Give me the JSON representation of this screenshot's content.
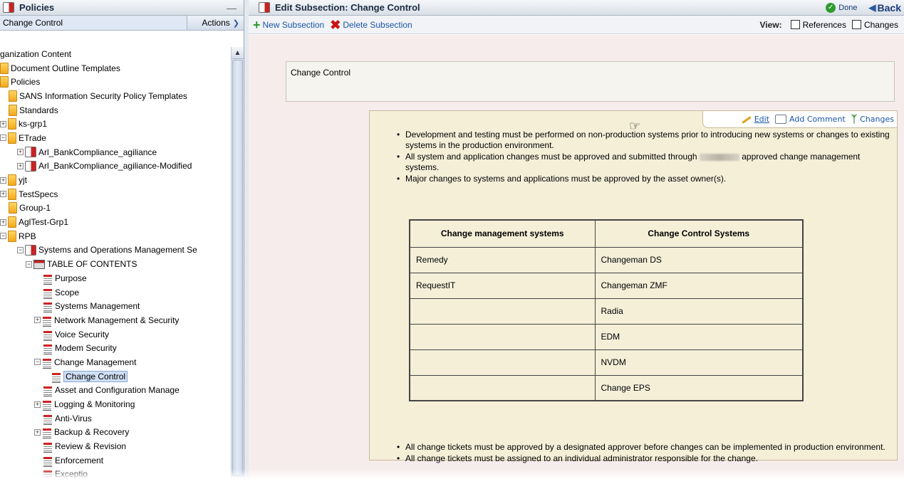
{
  "left_panel": {
    "title": "Policies",
    "minimize": "—",
    "context": "Change Control",
    "actions_label": "Actions",
    "scroll_up": "▲",
    "tree": [
      {
        "label": "ganization Content",
        "indent": 0,
        "expander": "",
        "icon": "none"
      },
      {
        "label": "Document Outline Templates",
        "indent": 0,
        "expander": "",
        "icon": "folder"
      },
      {
        "label": "Policies",
        "indent": 0,
        "expander": "",
        "icon": "folder"
      },
      {
        "label": "SANS Information Security Policy Templates",
        "indent": 1,
        "expander": "",
        "icon": "folder"
      },
      {
        "label": "Standards",
        "indent": 1,
        "expander": "",
        "icon": "folder"
      },
      {
        "label": "ks-grp1",
        "indent": 0,
        "expander": "+",
        "icon": "folder"
      },
      {
        "label": "ETrade",
        "indent": 0,
        "expander": "−",
        "icon": "folder"
      },
      {
        "label": "Arl_BankCompliance_agiliance",
        "indent": 2,
        "expander": "+",
        "icon": "book"
      },
      {
        "label": "Arl_BankCompliance_agiliance-Modified",
        "indent": 2,
        "expander": "+",
        "icon": "book"
      },
      {
        "label": "yjt",
        "indent": 0,
        "expander": "+",
        "icon": "folder"
      },
      {
        "label": "TestSpecs",
        "indent": 0,
        "expander": "+",
        "icon": "folder"
      },
      {
        "label": "Group-1",
        "indent": 1,
        "expander": "",
        "icon": "folder"
      },
      {
        "label": "AglTest-Grp1",
        "indent": 0,
        "expander": "+",
        "icon": "folder"
      },
      {
        "label": "RPB",
        "indent": 0,
        "expander": "−",
        "icon": "folder"
      },
      {
        "label": "Systems and Operations Management Se",
        "indent": 2,
        "expander": "−",
        "icon": "book"
      },
      {
        "label": "TABLE OF CONTENTS",
        "indent": 3,
        "expander": "−",
        "icon": "toc"
      },
      {
        "label": "Purpose",
        "indent": 5,
        "expander": "",
        "icon": "doc"
      },
      {
        "label": "Scope",
        "indent": 5,
        "expander": "",
        "icon": "doc"
      },
      {
        "label": "Systems Management",
        "indent": 5,
        "expander": "",
        "icon": "doc"
      },
      {
        "label": "Network Management & Security",
        "indent": 4,
        "expander": "+",
        "icon": "doc"
      },
      {
        "label": "Voice Security",
        "indent": 5,
        "expander": "",
        "icon": "doc"
      },
      {
        "label": "Modem Security",
        "indent": 5,
        "expander": "",
        "icon": "doc"
      },
      {
        "label": "Change Management",
        "indent": 4,
        "expander": "−",
        "icon": "doc"
      },
      {
        "label": "Change Control",
        "indent": 6,
        "expander": "",
        "icon": "doc",
        "selected": true
      },
      {
        "label": "Asset and Configuration Manage",
        "indent": 5,
        "expander": "",
        "icon": "doc"
      },
      {
        "label": "Logging & Monitoring",
        "indent": 4,
        "expander": "+",
        "icon": "doc"
      },
      {
        "label": "Anti-Virus",
        "indent": 5,
        "expander": "",
        "icon": "doc"
      },
      {
        "label": "Backup & Recovery",
        "indent": 4,
        "expander": "+",
        "icon": "doc"
      },
      {
        "label": "Review & Revision",
        "indent": 5,
        "expander": "",
        "icon": "doc"
      },
      {
        "label": "Enforcement",
        "indent": 5,
        "expander": "",
        "icon": "doc"
      },
      {
        "label": "Exceptio",
        "indent": 5,
        "expander": "",
        "icon": "doc"
      }
    ]
  },
  "right_panel": {
    "title": "Edit Subsection: Change Control",
    "done_label": "Done",
    "back_label": "Back",
    "toolbar": {
      "new_label": "New Subsection",
      "delete_label": "Delete Subsection",
      "view_label": "View:",
      "references_label": "References",
      "changes_label": "Changes"
    },
    "section_title": "Change Control",
    "editbar": {
      "edit_label": "Edit",
      "comment_label": "Add Comment",
      "changes_label": "Changes"
    },
    "bullets_top": [
      {
        "text": "Development and testing must be performed on non-production systems prior to introducing new systems or changes to existing systems in the production environment."
      },
      {
        "pre": "All system and application changes must be approved and submitted through ",
        "post": " approved change management systems."
      },
      {
        "text": "Major changes to systems and applications must be approved by the asset owner(s)."
      }
    ],
    "table": {
      "headers": [
        "Change management systems",
        "Change Control Systems"
      ],
      "rows": [
        [
          "Remedy",
          "Changeman DS"
        ],
        [
          "RequestIT",
          "Changeman ZMF"
        ],
        [
          "",
          "Radia"
        ],
        [
          "",
          "EDM"
        ],
        [
          "",
          "NVDM"
        ],
        [
          "",
          "Change EPS"
        ]
      ]
    },
    "bullets_bottom": [
      "All change tickets must be approved by a designated approver before changes can be implemented in production environment.",
      "All change tickets must be assigned to an individual administrator responsible for the change."
    ]
  },
  "colors": {
    "content_bg": "#f7ecec",
    "section_bg": "#f5efd8",
    "link": "#1a56a8",
    "selection": "#cfdff5"
  }
}
